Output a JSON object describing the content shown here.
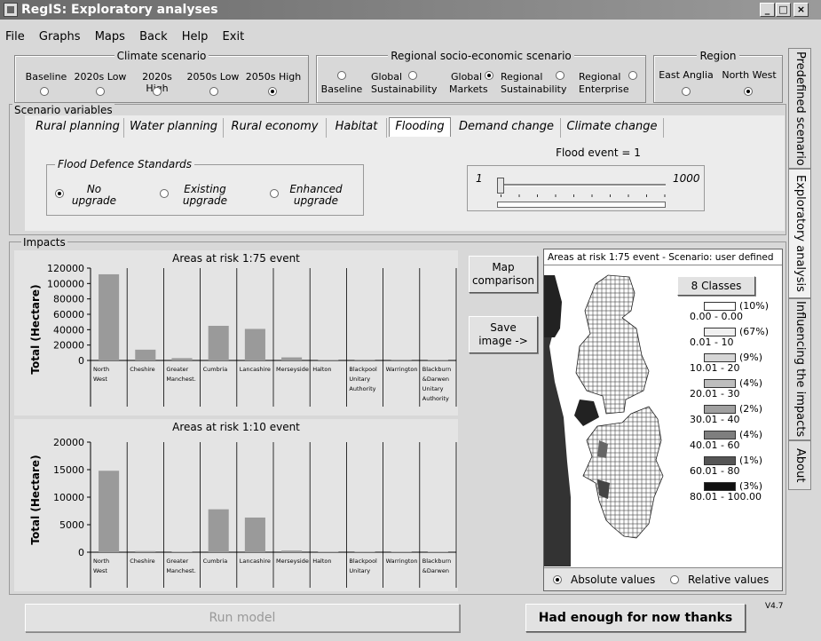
{
  "window": {
    "title": "RegIS: Exploratory analyses",
    "min": "_",
    "max": "□",
    "close": "×"
  },
  "menu": [
    "File",
    "Graphs",
    "Maps",
    "Back",
    "Help",
    "Exit"
  ],
  "climate": {
    "title": "Climate scenario",
    "options": [
      {
        "label": "Baseline",
        "selected": false
      },
      {
        "label": "2020s Low",
        "selected": false
      },
      {
        "label": "2020s High",
        "selected": false
      },
      {
        "label": "2050s Low",
        "selected": false
      },
      {
        "label": "2050s High",
        "selected": true
      }
    ]
  },
  "socio": {
    "title": "Regional socio-economic scenario",
    "options": [
      {
        "label": "Baseline",
        "selected": false
      },
      {
        "label": "Global Sustainability",
        "line1": "Global",
        "line2": "Sustainability",
        "selected": false
      },
      {
        "label": "Global Markets",
        "line1": "Global",
        "line2": "Markets",
        "selected": true
      },
      {
        "label": "Regional Sustainability",
        "line1": "Regional",
        "line2": "Sustainability",
        "selected": false
      },
      {
        "label": "Regional Enterprise",
        "line1": "Regional",
        "line2": "Enterprise",
        "selected": false
      }
    ]
  },
  "region": {
    "title": "Region",
    "options": [
      {
        "label": "East Anglia",
        "selected": false
      },
      {
        "label": "North West",
        "selected": true
      }
    ]
  },
  "scenario_vars": {
    "label": "Scenario variables",
    "tabs": [
      "Rural planning",
      "Water planning",
      "Rural economy",
      "Habitat",
      "Flooding",
      "Demand change",
      "Climate change"
    ],
    "active_tab": "Flooding",
    "fds": {
      "title": "Flood Defence Standards",
      "options": [
        {
          "line1": "No",
          "line2": "upgrade",
          "selected": true
        },
        {
          "line1": "Existing",
          "line2": "upgrade",
          "selected": false
        },
        {
          "line1": "Enhanced",
          "line2": "upgrade",
          "selected": false
        }
      ]
    },
    "flood_event": {
      "label": "Flood event = 1",
      "min": "1",
      "max": "1000",
      "value": 1
    }
  },
  "impacts": {
    "label": "Impacts",
    "ylabel": "Total (Hectare)",
    "categories": [
      "North West",
      "Cheshire",
      "Greater Manchest.",
      "Cumbria",
      "Lancashire",
      "Merseyside",
      "Halton",
      "Blackpool Unitary Authority",
      "Warrington",
      "Blackburn &Darwen Unitary Authority"
    ],
    "cat_lines": [
      [
        "North",
        "West"
      ],
      [
        "Cheshire"
      ],
      [
        "Greater",
        "Manchest."
      ],
      [
        "Cumbria"
      ],
      [
        "Lancashire"
      ],
      [
        "Merseyside"
      ],
      [
        "Halton"
      ],
      [
        "Blackpool",
        "Unitary",
        "Authority"
      ],
      [
        "Warrington"
      ],
      [
        "Blackburn",
        "&Darwen",
        "Unitary",
        "Authority"
      ]
    ],
    "cat_lines_2": [
      [
        "North",
        "West"
      ],
      [
        "Cheshire"
      ],
      [
        "Greater",
        "Manchest."
      ],
      [
        "Cumbria"
      ],
      [
        "Lancashire"
      ],
      [
        "Merseyside"
      ],
      [
        "Halton"
      ],
      [
        "Blackpool",
        "Unitary"
      ],
      [
        "Warrington"
      ],
      [
        "Blackburn",
        "&Darwen"
      ]
    ]
  },
  "chart_data": [
    {
      "type": "bar",
      "title": "Areas at risk 1:75 event",
      "ylabel": "Total (Hectare)",
      "categories": [
        "North West",
        "Cheshire",
        "Greater Manchest.",
        "Cumbria",
        "Lancashire",
        "Merseyside",
        "Halton",
        "Blackpool Unitary Authority",
        "Warrington",
        "Blackburn &Darwen Unitary Authority"
      ],
      "values": [
        112000,
        14000,
        3000,
        45000,
        41000,
        4000,
        500,
        1000,
        1000,
        500
      ],
      "yticks": [
        0,
        20000,
        40000,
        60000,
        80000,
        100000,
        120000
      ],
      "ylim": [
        0,
        120000
      ]
    },
    {
      "type": "bar",
      "title": "Areas at risk 1:10 event",
      "ylabel": "Total (Hectare)",
      "categories": [
        "North West",
        "Cheshire",
        "Greater Manchest.",
        "Cumbria",
        "Lancashire",
        "Merseyside",
        "Halton",
        "Blackpool Unitary",
        "Warrington",
        "Blackburn &Darwen"
      ],
      "values": [
        14800,
        200,
        100,
        7800,
        6300,
        300,
        100,
        100,
        100,
        100
      ],
      "yticks": [
        0,
        5000,
        10000,
        15000,
        20000
      ],
      "ylim": [
        0,
        20000
      ]
    }
  ],
  "buttons": {
    "map_comparison": "Map comparison",
    "map_line1": "Map",
    "map_line2": "comparison",
    "save_line1": "Save",
    "save_line2": "image ->",
    "run_model": "Run model",
    "enough": "Had enough for now thanks"
  },
  "map": {
    "title": "Areas at risk 1:75 event - Scenario: user defined",
    "classes_button": "8 Classes",
    "legend": [
      {
        "pct": "(10%)",
        "range": "0.00 - 0.00",
        "color": "#ffffff"
      },
      {
        "pct": "(67%)",
        "range": "0.01 - 10",
        "color": "#f0f0f0"
      },
      {
        "pct": "(9%)",
        "range": "10.01 - 20",
        "color": "#d6d6d6"
      },
      {
        "pct": "(4%)",
        "range": "20.01 - 30",
        "color": "#bdbdbd"
      },
      {
        "pct": "(2%)",
        "range": "30.01 - 40",
        "color": "#a0a0a0"
      },
      {
        "pct": "(4%)",
        "range": "40.01 - 60",
        "color": "#7e7e7e"
      },
      {
        "pct": "(1%)",
        "range": "60.01 - 80",
        "color": "#555555"
      },
      {
        "pct": "(3%)",
        "range": "80.01 - 100.00",
        "color": "#111111"
      }
    ],
    "absolute": "Absolute values",
    "relative": "Relative values",
    "absolute_selected": true
  },
  "side_tabs": [
    "Predefined scenario",
    "Exploratory analysis",
    "Influencing the impacts",
    "About"
  ],
  "version": "V4.7"
}
